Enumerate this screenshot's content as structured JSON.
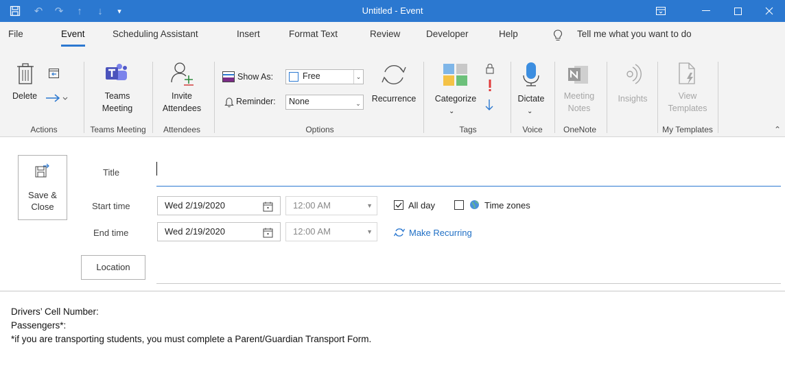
{
  "window": {
    "title": "Untitled  -  Event"
  },
  "tabs": [
    "File",
    "Event",
    "Scheduling Assistant",
    "Insert",
    "Format Text",
    "Review",
    "Developer",
    "Help"
  ],
  "tell_me": "Tell me what you want to do",
  "ribbon": {
    "delete": "Delete",
    "teams_meeting_l1": "Teams",
    "teams_meeting_l2": "Meeting",
    "invite_l1": "Invite",
    "invite_l2": "Attendees",
    "show_as_label": "Show As:",
    "show_as_value": "Free",
    "reminder_label": "Reminder:",
    "reminder_value": "None",
    "recurrence": "Recurrence",
    "categorize": "Categorize",
    "dictate": "Dictate",
    "meeting_notes_l1": "Meeting",
    "meeting_notes_l2": "Notes",
    "insights": "Insights",
    "view_templates_l1": "View",
    "view_templates_l2": "Templates",
    "groups": {
      "actions": "Actions",
      "teams_meeting": "Teams Meeting",
      "attendees": "Attendees",
      "options": "Options",
      "tags": "Tags",
      "voice": "Voice",
      "onenote": "OneNote",
      "my_templates": "My Templates"
    }
  },
  "form": {
    "save_close_l1": "Save &",
    "save_close_l2": "Close",
    "title_label": "Title",
    "title_value": "",
    "start_label": "Start time",
    "start_date": "Wed 2/19/2020",
    "start_time": "12:00 AM",
    "end_label": "End time",
    "end_date": "Wed 2/19/2020",
    "end_time": "12:00 AM",
    "all_day": "All day",
    "all_day_checked": true,
    "time_zones": "Time zones",
    "make_recurring": "Make Recurring",
    "location_button": "Location",
    "location_value": ""
  },
  "body_lines": [
    "Drivers’ Cell Number:",
    "Passengers*:",
    "*if you are transporting students, you must complete a Parent/Guardian Transport Form."
  ],
  "colors": {
    "titlebar": "#2b78d0",
    "ribbon_bg": "#f3f3f3",
    "accent": "#2b78d0"
  }
}
